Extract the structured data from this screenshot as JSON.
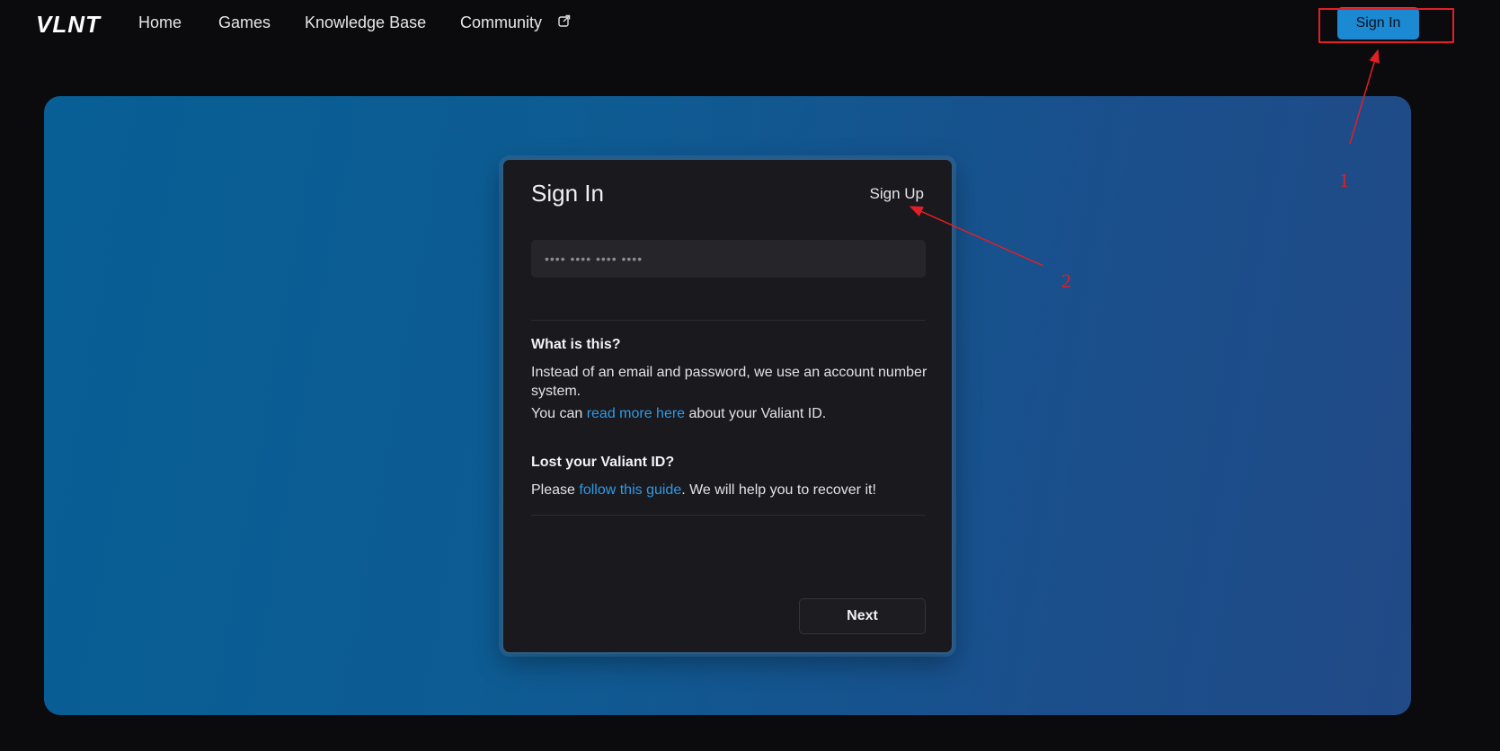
{
  "nav": {
    "logo": "VLNT",
    "links": [
      "Home",
      "Games",
      "Knowledge Base",
      "Community"
    ],
    "external_icon": "external-link-icon",
    "signin_label": "Sign In"
  },
  "card": {
    "title": "Sign In",
    "signup_label": "Sign Up",
    "input_placeholder": "•••• •••• •••• ••••",
    "what_heading": "What is this?",
    "what_text": "Instead of an email and password, we use an account number system.",
    "read_prefix": "You can ",
    "read_link": "read more here",
    "read_suffix": " about your Valiant ID.",
    "lost_heading": "Lost your Valiant ID?",
    "lost_prefix": "Please ",
    "lost_link": "follow this guide",
    "lost_suffix": ". We will help you to recover it!",
    "next_label": "Next"
  },
  "annotations": {
    "label_1": "1",
    "label_2": "2",
    "color": "#e21f26"
  },
  "colors": {
    "accent": "#1b8ad3",
    "link": "#2f9ae6",
    "page_bg": "#0b0b0e",
    "card_bg": "#19191e"
  }
}
